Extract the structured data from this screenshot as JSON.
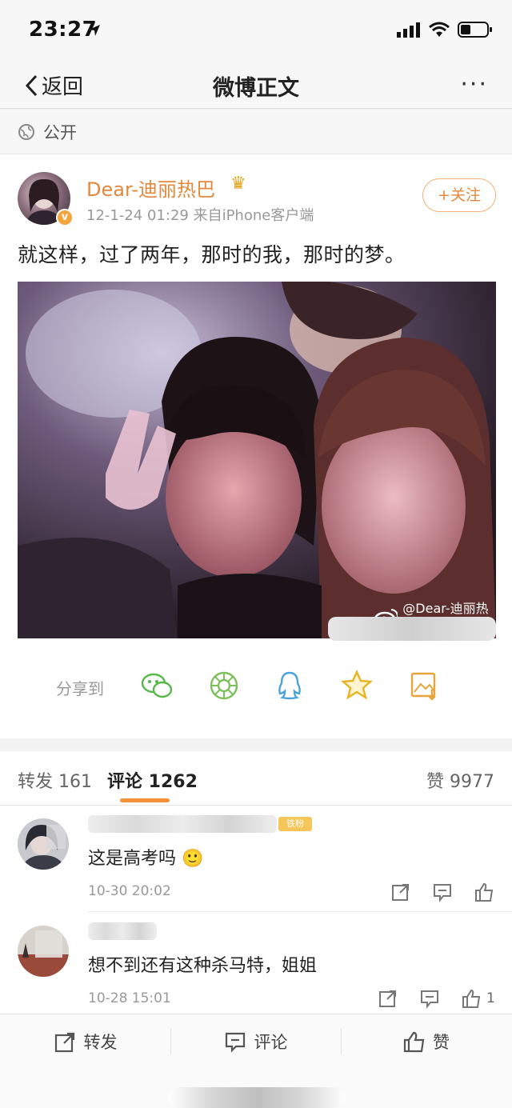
{
  "status_bar": {
    "time": "23:27"
  },
  "nav": {
    "back_label": "返回",
    "title": "微博正文",
    "more": "···"
  },
  "visibility": {
    "label": "公开"
  },
  "post": {
    "author": "Dear-迪丽热巴",
    "meta": "12-1-24 01:29  来自iPhone客户端",
    "follow_label": "+关注",
    "text": "就这样，过了两年，那时的我，那时的梦。",
    "watermark": "@Dear-迪丽热巴",
    "share_label": "分享到",
    "share_icons": [
      "wechat-icon",
      "moments-icon",
      "qq-icon",
      "qzone-icon",
      "save-image-icon"
    ]
  },
  "tabs": {
    "repost": "转发 161",
    "comments": "评论 1262",
    "likes": "赞 9977"
  },
  "comments": [
    {
      "fan_badge": "铁粉",
      "text": "这是高考吗",
      "emoji": "🙂",
      "time": "10-30 20:02",
      "likes": ""
    },
    {
      "text": "想不到还有这种杀马特，姐姐",
      "time": "10-28 15:01",
      "likes": "1"
    }
  ],
  "action_bar": {
    "repost": "转发",
    "comment": "评论",
    "like": "赞"
  },
  "colors": {
    "accent": "#f8913a",
    "author_name": "#e3883d",
    "background": "#f2f2f2"
  }
}
